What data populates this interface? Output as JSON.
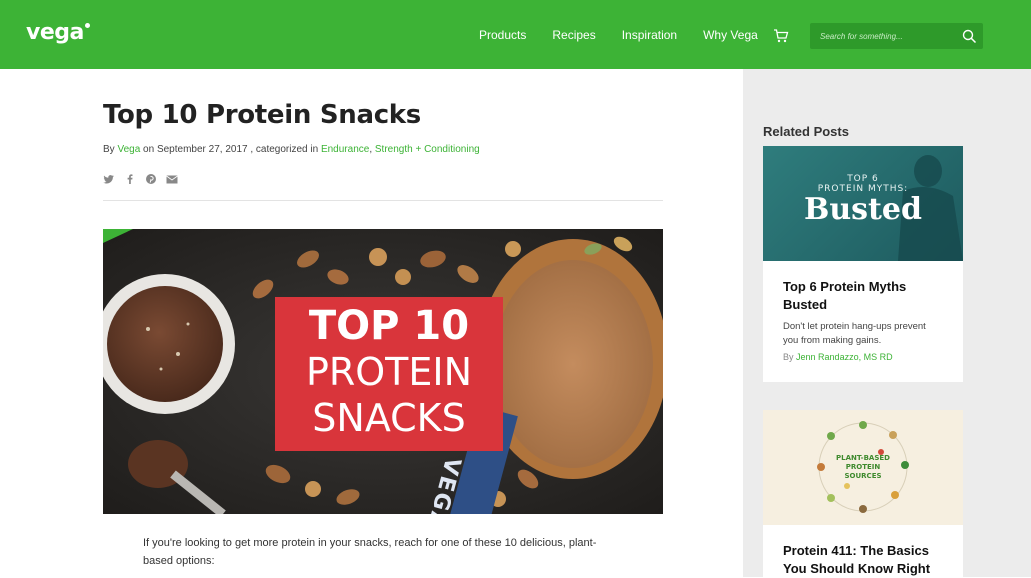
{
  "header": {
    "logo": "vega",
    "nav": [
      "Products",
      "Recipes",
      "Inspiration",
      "Why Vega"
    ],
    "cart_icon": "cart-icon",
    "search_placeholder": "Search for something...",
    "search_icon": "search-icon",
    "brand_color": "#3db336"
  },
  "article": {
    "title": "Top 10 Protein Snacks",
    "meta": {
      "by_label": "By",
      "author": "Vega",
      "date_text": "on September 27, 2017 , categorized in",
      "categories": [
        "Endurance",
        "Strength + Conditioning"
      ],
      "separator": ","
    },
    "share_icons": [
      "twitter-icon",
      "facebook-icon",
      "pinterest-icon",
      "email-icon"
    ],
    "hero": {
      "line1": "TOP 10",
      "line2": "PROTEIN",
      "line3": "SNACKS",
      "bar_text": "VEGA"
    },
    "intro": "If you're looking to get more protein in your snacks, reach for one of these 10 delicious, plant-based options:"
  },
  "sidebar": {
    "heading": "Related Posts",
    "posts": [
      {
        "thumb_line1": "TOP 6",
        "thumb_line2": "PROTEIN MYTHS:",
        "thumb_line3": "Busted",
        "title": "Top 6 Protein Myths Busted",
        "excerpt": "Don't let protein hang-ups prevent you from making gains.",
        "by_label": "By",
        "author": "Jenn Randazzo, MS RD"
      },
      {
        "thumb_line1": "PLANT-BASED",
        "thumb_line2": "PROTEIN",
        "thumb_line3": "SOURCES",
        "title": "Protein 411: The Basics You Should Know Right"
      }
    ]
  }
}
